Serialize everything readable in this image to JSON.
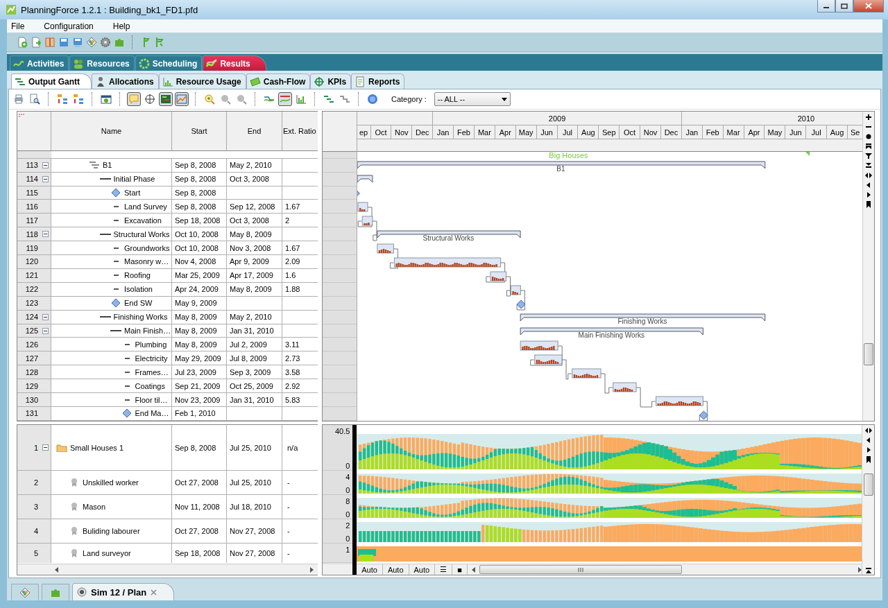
{
  "window": {
    "title": "PlanningForce 1.2.1 : Building_bk1_FD1.pfd"
  },
  "menu": [
    "File",
    "Configuration",
    "Help"
  ],
  "main_tabs": [
    {
      "label": "Activities",
      "selected": false
    },
    {
      "label": "Resources",
      "selected": false
    },
    {
      "label": "Scheduling",
      "selected": false
    },
    {
      "label": "Results",
      "selected": true
    }
  ],
  "sub_tabs": [
    {
      "label": "Output Gantt",
      "selected": true
    },
    {
      "label": "Allocations",
      "selected": false
    },
    {
      "label": "Resource Usage",
      "selected": false
    },
    {
      "label": "Cash-Flow",
      "selected": false
    },
    {
      "label": "KPIs",
      "selected": false
    },
    {
      "label": "Reports",
      "selected": false
    }
  ],
  "gantt_toolbar": {
    "buttons": [
      {
        "pressed": false
      },
      {
        "pressed": false
      },
      {
        "pressed": false
      },
      {
        "pressed": false
      },
      {
        "pressed": false
      },
      {
        "pressed": true
      },
      {
        "pressed": false
      },
      {
        "pressed": true
      },
      {
        "pressed": true
      },
      {
        "pressed": false
      },
      {
        "pressed": false
      },
      {
        "pressed": false
      },
      {
        "pressed": false
      },
      {
        "pressed": true
      },
      {
        "pressed": false
      },
      {
        "pressed": false
      },
      {
        "pressed": false
      },
      {
        "pressed": false
      }
    ],
    "category_label": "Category :",
    "category_value": "-- ALL --"
  },
  "table": {
    "columns": [
      "Name",
      "Start",
      "End",
      "Ext. Ratio"
    ],
    "rows": [
      {
        "num": "113",
        "name": "B1",
        "start": "Sep 8, 2008",
        "end": "May 2, 2010",
        "kind": "building",
        "expanded": true,
        "bar_label": "B1",
        "children": [
          {
            "num": "114",
            "name": "Initial Phase",
            "start": "Sep 8, 2008",
            "end": "Oct 3, 2008",
            "kind": "phase",
            "expanded": true,
            "children": [
              {
                "num": "115",
                "name": "Start",
                "start": "Sep 8, 2008",
                "kind": "milestone"
              },
              {
                "num": "116",
                "name": "Land Survey",
                "start": "Sep 8, 2008",
                "end": "Sep 12, 2008",
                "ratio": "1.67",
                "kind": "task"
              },
              {
                "num": "117",
                "name": "Excavation",
                "start": "Sep 18, 2008",
                "end": "Oct 3, 2008",
                "ratio": "2",
                "kind": "task"
              }
            ]
          },
          {
            "num": "118",
            "name": "Structural Works",
            "start": "Oct 10, 2008",
            "end": "May 8, 2009",
            "kind": "phase",
            "expanded": true,
            "bar_label": "Structural Works",
            "children": [
              {
                "num": "119",
                "name": "Groundworks",
                "start": "Oct 10, 2008",
                "end": "Nov 3, 2008",
                "ratio": "1.67",
                "kind": "task"
              },
              {
                "num": "120",
                "name": "Masonry w…",
                "start": "Nov 4, 2008",
                "end": "Apr 9, 2009",
                "ratio": "2.09",
                "kind": "task"
              },
              {
                "num": "121",
                "name": "Roofing",
                "start": "Mar 25, 2009",
                "end": "Apr 17, 2009",
                "ratio": "1.6",
                "kind": "task"
              },
              {
                "num": "122",
                "name": "Isolation",
                "start": "Apr 24, 2009",
                "end": "May 8, 2009",
                "ratio": "1.88",
                "kind": "task"
              },
              {
                "num": "123",
                "name": "End SW",
                "start": "May 9, 2009",
                "kind": "milestone"
              }
            ]
          },
          {
            "num": "124",
            "name": "Finishing Works",
            "start": "May 8, 2009",
            "end": "May 2, 2010",
            "kind": "phase",
            "expanded": true,
            "bar_label": "Finishing Works",
            "children": [
              {
                "num": "125",
                "name": "Main Finish…",
                "start": "May 8, 2009",
                "end": "Jan 31, 2010",
                "kind": "phase",
                "expanded": true,
                "bar_label": "Main Finishing Works",
                "children": [
                  {
                    "num": "126",
                    "name": "Plumbing",
                    "start": "May 8, 2009",
                    "end": "Jul 2, 2009",
                    "ratio": "3.11",
                    "kind": "task"
                  },
                  {
                    "num": "127",
                    "name": "Electricity",
                    "start": "May 29, 2009",
                    "end": "Jul 8, 2009",
                    "ratio": "2.73",
                    "kind": "task"
                  },
                  {
                    "num": "128",
                    "name": "Frames…",
                    "start": "Jul 23, 2009",
                    "end": "Sep 3, 2009",
                    "ratio": "3.58",
                    "kind": "task"
                  },
                  {
                    "num": "129",
                    "name": "Coatings",
                    "start": "Sep 21, 2009",
                    "end": "Oct 25, 2009",
                    "ratio": "2.92",
                    "kind": "task"
                  },
                  {
                    "num": "130",
                    "name": "Floor til…",
                    "start": "Nov 23, 2009",
                    "end": "Jan 31, 2010",
                    "ratio": "5.83",
                    "kind": "task"
                  },
                  {
                    "num": "131",
                    "name": "End Ma…",
                    "start": "Feb 1, 2010",
                    "kind": "milestone"
                  }
                ]
              }
            ]
          }
        ]
      }
    ]
  },
  "timeline": {
    "years": [
      "2009",
      "2010"
    ],
    "months": [
      "ep",
      "Oct",
      "Nov",
      "Dec",
      "Jan",
      "Feb",
      "Mar",
      "Apr",
      "May",
      "Jun",
      "Jul",
      "Aug",
      "Sep",
      "Oct",
      "Nov",
      "Dec",
      "Jan",
      "Feb",
      "Mar",
      "Apr",
      "May",
      "Jun",
      "Jul",
      "Aug",
      "Se"
    ]
  },
  "gantt": {
    "top_label": "Big Houses"
  },
  "resource_table": {
    "rows": [
      {
        "num": "1",
        "name": "Small Houses 1",
        "start": "Sep 8, 2008",
        "end": "Jul 25, 2010",
        "ratio": "n/a",
        "kind": "folder",
        "expanded": true,
        "children": [
          {
            "num": "2",
            "name": "Unskilled worker",
            "start": "Oct 27, 2008",
            "end": "Jul 25, 2010",
            "ratio": "-",
            "kind": "resource"
          },
          {
            "num": "3",
            "name": "Mason",
            "start": "Nov 11, 2008",
            "end": "Jul 18, 2010",
            "ratio": "-",
            "kind": "resource"
          },
          {
            "num": "4",
            "name": "Buliding labourer",
            "start": "Oct 27, 2008",
            "end": "Nov 27, 2008",
            "ratio": "-",
            "kind": "resource"
          },
          {
            "num": "5",
            "name": "Land surveyor",
            "start": "Sep 18, 2008",
            "end": "Nov 27, 2008",
            "ratio": "-",
            "kind": "resource"
          }
        ]
      }
    ]
  },
  "usage": {
    "rows": [
      {
        "ymax": "40.5",
        "ymin": "0"
      },
      {
        "ymax": "4",
        "ymin": "0"
      },
      {
        "ymax": "8",
        "ymin": "0"
      },
      {
        "ymax": "2",
        "ymin": "0"
      },
      {
        "ymax": "1"
      }
    ],
    "buttons": [
      "Auto",
      "Auto",
      "Auto",
      "☰",
      "■"
    ]
  },
  "document_tab": {
    "label": "Sim 12 / Plan",
    "selected": true
  }
}
